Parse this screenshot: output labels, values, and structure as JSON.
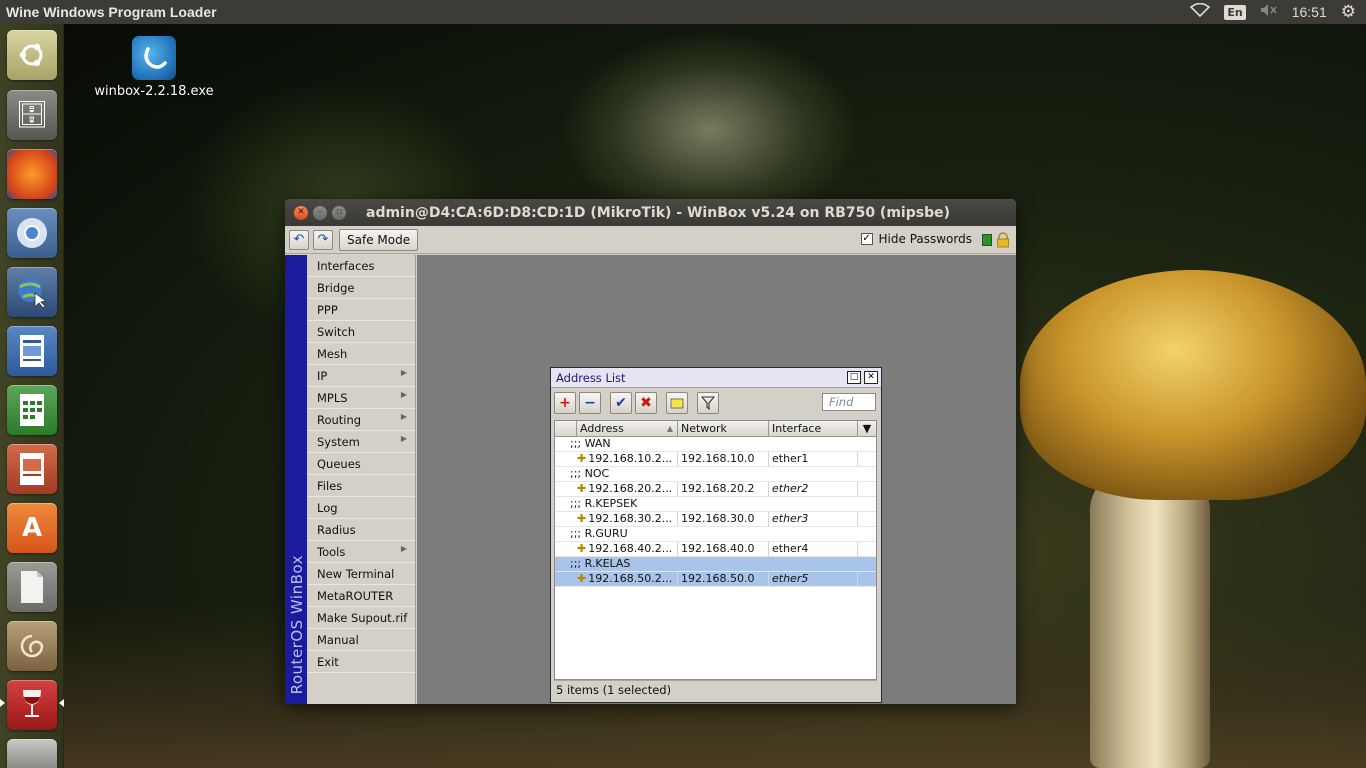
{
  "top_panel": {
    "app_title": "Wine Windows Program Loader",
    "lang": "En",
    "clock": "16:51"
  },
  "launcher": {
    "items": [
      {
        "name": "dash-home",
        "icon": "ubuntu-logo-icon"
      },
      {
        "name": "files",
        "icon": "file-cabinet-icon"
      },
      {
        "name": "firefox",
        "icon": "firefox-icon"
      },
      {
        "name": "chromium",
        "icon": "chromium-icon"
      },
      {
        "name": "web-browser",
        "icon": "globe-cursor-icon"
      },
      {
        "name": "libreoffice-writer",
        "icon": "writer-icon"
      },
      {
        "name": "libreoffice-calc",
        "icon": "calc-icon"
      },
      {
        "name": "libreoffice-impress",
        "icon": "impress-icon"
      },
      {
        "name": "software-center",
        "icon": "shopping-bag-icon"
      },
      {
        "name": "libreoffice",
        "icon": "document-icon"
      },
      {
        "name": "debian-package",
        "icon": "package-icon"
      },
      {
        "name": "wine",
        "icon": "wine-glass-icon"
      }
    ]
  },
  "desktop": {
    "icon_label": "winbox-2.2.18.exe"
  },
  "winbox": {
    "title": "admin@D4:CA:6D:D8:CD:1D (MikroTik) - WinBox v5.24 on RB750 (mipsbe)",
    "safe_mode": "Safe Mode",
    "hide_passwords": "Hide Passwords",
    "vertical_brand": "RouterOS WinBox",
    "menu": [
      {
        "label": "Interfaces",
        "sub": false
      },
      {
        "label": "Bridge",
        "sub": false
      },
      {
        "label": "PPP",
        "sub": false
      },
      {
        "label": "Switch",
        "sub": false
      },
      {
        "label": "Mesh",
        "sub": false
      },
      {
        "label": "IP",
        "sub": true
      },
      {
        "label": "MPLS",
        "sub": true
      },
      {
        "label": "Routing",
        "sub": true
      },
      {
        "label": "System",
        "sub": true
      },
      {
        "label": "Queues",
        "sub": false
      },
      {
        "label": "Files",
        "sub": false
      },
      {
        "label": "Log",
        "sub": false
      },
      {
        "label": "Radius",
        "sub": false
      },
      {
        "label": "Tools",
        "sub": true
      },
      {
        "label": "New Terminal",
        "sub": false
      },
      {
        "label": "MetaROUTER",
        "sub": false
      },
      {
        "label": "Make Supout.rif",
        "sub": false
      },
      {
        "label": "Manual",
        "sub": false
      },
      {
        "label": "Exit",
        "sub": false
      }
    ]
  },
  "address_list": {
    "title": "Address List",
    "find_placeholder": "Find",
    "columns": [
      "Address",
      "Network",
      "Interface"
    ],
    "rows": [
      {
        "type": "comment",
        "text": ";;; WAN"
      },
      {
        "type": "data",
        "address": "192.168.10.2...",
        "network": "192.168.10.0",
        "interface": "ether1",
        "italic": false
      },
      {
        "type": "comment",
        "text": ";;; NOC"
      },
      {
        "type": "data",
        "address": "192.168.20.2...",
        "network": "192.168.20.2",
        "interface": "ether2",
        "italic": true
      },
      {
        "type": "comment",
        "text": ";;; R.KEPSEK"
      },
      {
        "type": "data",
        "address": "192.168.30.2...",
        "network": "192.168.30.0",
        "interface": "ether3",
        "italic": true
      },
      {
        "type": "comment",
        "text": ";;; R.GURU"
      },
      {
        "type": "data",
        "address": "192.168.40.2...",
        "network": "192.168.40.0",
        "interface": "ether4",
        "italic": false
      },
      {
        "type": "comment",
        "text": ";;; R.KELAS",
        "selected": true
      },
      {
        "type": "data",
        "address": "192.168.50.2...",
        "network": "192.168.50.0",
        "interface": "ether5",
        "italic": true,
        "selected": true
      }
    ],
    "status": "5 items (1 selected)"
  }
}
